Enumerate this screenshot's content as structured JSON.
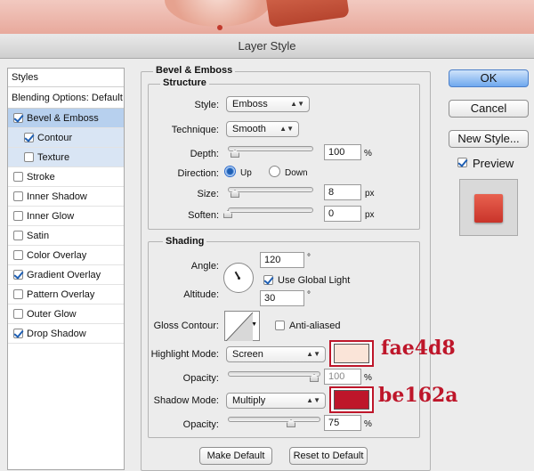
{
  "window": {
    "title": "Layer Style"
  },
  "styles_panel": {
    "header": "Styles",
    "blending_options": "Blending Options: Default",
    "items": [
      {
        "label": "Bevel & Emboss",
        "checked": true,
        "state": "selected"
      },
      {
        "label": "Contour",
        "checked": true,
        "state": "sub"
      },
      {
        "label": "Texture",
        "checked": false,
        "state": "sub"
      },
      {
        "label": "Stroke",
        "checked": false
      },
      {
        "label": "Inner Shadow",
        "checked": false
      },
      {
        "label": "Inner Glow",
        "checked": false
      },
      {
        "label": "Satin",
        "checked": false
      },
      {
        "label": "Color Overlay",
        "checked": false
      },
      {
        "label": "Gradient Overlay",
        "checked": true
      },
      {
        "label": "Pattern Overlay",
        "checked": false
      },
      {
        "label": "Outer Glow",
        "checked": false
      },
      {
        "label": "Drop Shadow",
        "checked": true
      }
    ]
  },
  "bevel": {
    "title": "Bevel & Emboss",
    "structure": {
      "title": "Structure",
      "style_label": "Style:",
      "style_value": "Emboss",
      "technique_label": "Technique:",
      "technique_value": "Smooth",
      "depth_label": "Depth:",
      "depth_value": "100",
      "depth_unit": "%",
      "direction_label": "Direction:",
      "up_label": "Up",
      "down_label": "Down",
      "direction_selected": "Up",
      "size_label": "Size:",
      "size_value": "8",
      "size_unit": "px",
      "soften_label": "Soften:",
      "soften_value": "0",
      "soften_unit": "px"
    },
    "shading": {
      "title": "Shading",
      "angle_label": "Angle:",
      "angle_value": "120",
      "angle_unit": "°",
      "global_light_label": "Use Global Light",
      "global_light_checked": true,
      "altitude_label": "Altitude:",
      "altitude_value": "30",
      "altitude_unit": "°",
      "gloss_label": "Gloss Contour:",
      "anti_aliased_label": "Anti-aliased",
      "anti_aliased_checked": false,
      "highlight_label": "Highlight Mode:",
      "highlight_value": "Screen",
      "highlight_color": "#fae4d8",
      "highlight_opacity_label": "Opacity:",
      "highlight_opacity_value": "100",
      "highlight_opacity_unit": "%",
      "shadow_label": "Shadow Mode:",
      "shadow_value": "Multiply",
      "shadow_color": "#be162a",
      "shadow_opacity_label": "Opacity:",
      "shadow_opacity_value": "75",
      "shadow_opacity_unit": "%"
    },
    "make_default": "Make Default",
    "reset_default": "Reset to Default"
  },
  "right": {
    "ok": "OK",
    "cancel": "Cancel",
    "new_style": "New Style...",
    "preview_label": "Preview",
    "preview_checked": true
  },
  "annotations": {
    "highlight_hex": "fae4d8",
    "shadow_hex": "be162a"
  }
}
